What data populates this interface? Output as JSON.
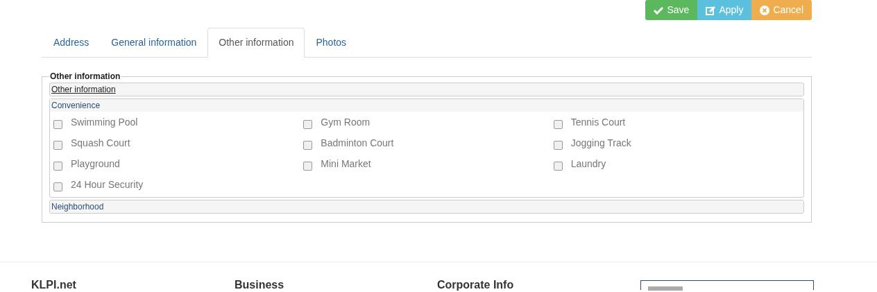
{
  "actions": [
    {
      "kind": "save",
      "label": "Save"
    },
    {
      "kind": "apply",
      "label": "Apply"
    },
    {
      "kind": "cancel",
      "label": "Cancel"
    }
  ],
  "tabs": [
    {
      "label": "Address",
      "selected": false
    },
    {
      "label": "General information",
      "selected": false
    },
    {
      "label": "Other information",
      "selected": true
    },
    {
      "label": "Photos",
      "selected": false
    }
  ],
  "fieldset": {
    "legend": "Other information",
    "header": "Other information",
    "sections": [
      {
        "title": "Convenience",
        "expanded": true,
        "items": [
          {
            "label": "Swimming Pool",
            "checked": false
          },
          {
            "label": "Gym Room",
            "checked": false
          },
          {
            "label": "Tennis Court",
            "checked": false
          },
          {
            "label": "Squash Court",
            "checked": false
          },
          {
            "label": "Badminton Court",
            "checked": false
          },
          {
            "label": "Jogging Track",
            "checked": false
          },
          {
            "label": "Playground",
            "checked": false
          },
          {
            "label": "Mini Market",
            "checked": false
          },
          {
            "label": "Laundry",
            "checked": false
          },
          {
            "label": "24 Hour Security",
            "checked": false
          }
        ]
      },
      {
        "title": "Neighborhood",
        "expanded": false
      }
    ]
  },
  "footer": {
    "headings": [
      "KLPI.net",
      "Business",
      "Corporate Info"
    ]
  }
}
